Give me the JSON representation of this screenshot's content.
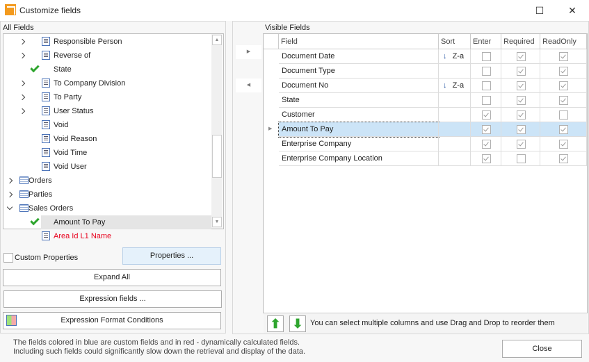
{
  "window": {
    "title": "Customize fields",
    "maximize": "☐",
    "close": "✕"
  },
  "all_fields": {
    "label": "All Fields",
    "items": [
      {
        "label": "Responsible Person",
        "level": 2,
        "expander": "right",
        "icon": "field",
        "color": "normal"
      },
      {
        "label": "Reverse of",
        "level": 2,
        "expander": "right",
        "icon": "field",
        "color": "normal"
      },
      {
        "label": "State",
        "level": 2,
        "expander": "",
        "icon": "check",
        "color": "normal"
      },
      {
        "label": "To Company Division",
        "level": 2,
        "expander": "right",
        "icon": "field",
        "color": "normal"
      },
      {
        "label": "To Party",
        "level": 2,
        "expander": "right",
        "icon": "field",
        "color": "normal"
      },
      {
        "label": "User Status",
        "level": 2,
        "expander": "right",
        "icon": "field",
        "color": "normal"
      },
      {
        "label": "Void",
        "level": 2,
        "expander": "",
        "icon": "field",
        "color": "normal"
      },
      {
        "label": "Void Reason",
        "level": 2,
        "expander": "",
        "icon": "field",
        "color": "normal"
      },
      {
        "label": "Void Time",
        "level": 2,
        "expander": "",
        "icon": "field",
        "color": "normal"
      },
      {
        "label": "Void User",
        "level": 2,
        "expander": "",
        "icon": "field",
        "color": "normal"
      },
      {
        "label": "Orders",
        "level": 1,
        "expander": "right",
        "icon": "table",
        "color": "normal"
      },
      {
        "label": "Parties",
        "level": 1,
        "expander": "right",
        "icon": "table",
        "color": "normal"
      },
      {
        "label": "Sales Orders",
        "level": 1,
        "expander": "down",
        "icon": "table",
        "color": "normal"
      },
      {
        "label": "Amount To Pay",
        "level": 2,
        "expander": "",
        "icon": "check",
        "color": "normal",
        "selected": true
      },
      {
        "label": "Area Id L1 Name",
        "level": 2,
        "expander": "",
        "icon": "field",
        "color": "red"
      }
    ]
  },
  "custom_properties": {
    "label": "Custom Properties",
    "checked": false
  },
  "buttons": {
    "properties": "Properties ...",
    "expand_all": "Expand All",
    "expression_fields": "Expression fields ...",
    "expression_format": "Expression Format Conditions",
    "close": "Close"
  },
  "visible_fields": {
    "label": "Visible Fields",
    "columns": [
      "Field",
      "Sort",
      "Enter",
      "Required",
      "ReadOnly"
    ],
    "rows": [
      {
        "field": "Document Date",
        "sort": "Z-a",
        "enter": false,
        "required": true,
        "readonly": true
      },
      {
        "field": "Document Type",
        "sort": "",
        "enter": false,
        "required": true,
        "readonly": true
      },
      {
        "field": "Document No",
        "sort": "Z-a",
        "enter": false,
        "required": true,
        "readonly": true
      },
      {
        "field": "State",
        "sort": "",
        "enter": false,
        "required": true,
        "readonly": true
      },
      {
        "field": "Customer",
        "sort": "",
        "enter": true,
        "required": true,
        "readonly": false
      },
      {
        "field": "Amount To Pay",
        "sort": "",
        "enter": true,
        "required": true,
        "readonly": true,
        "selected": true
      },
      {
        "field": "Enterprise Company",
        "sort": "",
        "enter": true,
        "required": true,
        "readonly": true
      },
      {
        "field": "Enterprise Company Location",
        "sort": "",
        "enter": true,
        "required": false,
        "readonly": true
      }
    ],
    "hint": "You can select multiple columns and use Drag and Drop to reorder them"
  },
  "footer": {
    "line1": "The fields colored in blue are custom fields and in red - dynamically calculated fields.",
    "line2": "Including such fields could significantly slow down the retrieval and display of the data."
  },
  "colors": {
    "accent": "#f39a1e",
    "selected_row": "#cce4f7",
    "calculated_field": "#e8001c",
    "check": "#2ea52e"
  }
}
